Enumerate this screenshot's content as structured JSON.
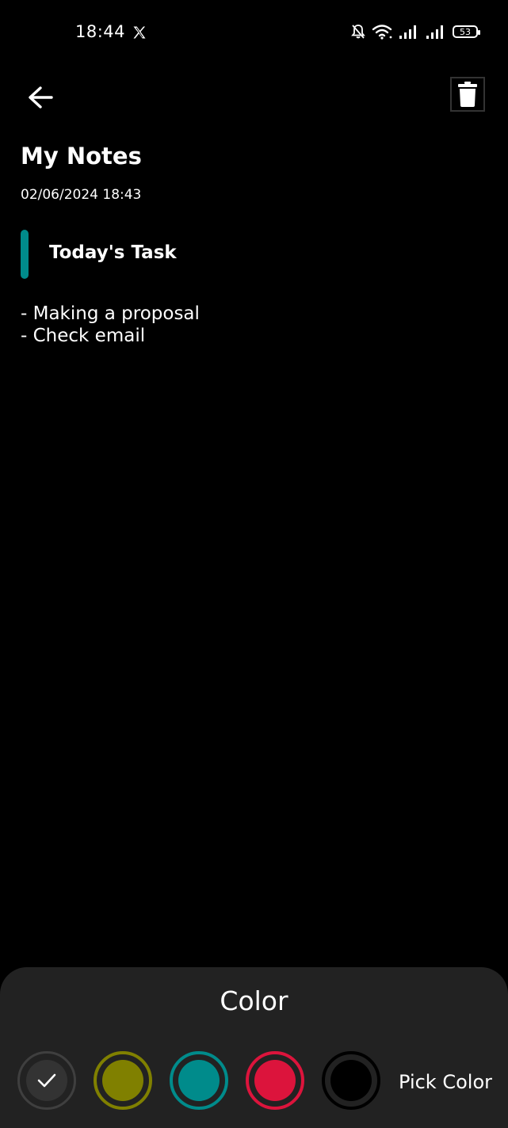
{
  "status_bar": {
    "time": "18:44",
    "battery": "53"
  },
  "note": {
    "title": "My Notes",
    "datetime": "02/06/2024 18:43",
    "subtitle": "Today's Task",
    "subtitle_indicator_color": "#008b8b",
    "body_lines": [
      "- Making a proposal",
      "- Check email"
    ]
  },
  "color_sheet": {
    "title": "Color",
    "pick_label": "Pick Color",
    "swatches": [
      {
        "name": "dark",
        "color": "#333333",
        "selected": true
      },
      {
        "name": "olive",
        "color": "#808000",
        "selected": false
      },
      {
        "name": "teal",
        "color": "#008b8b",
        "selected": false
      },
      {
        "name": "red",
        "color": "#dc143c",
        "selected": false
      },
      {
        "name": "black",
        "color": "#000000",
        "selected": false
      }
    ]
  }
}
